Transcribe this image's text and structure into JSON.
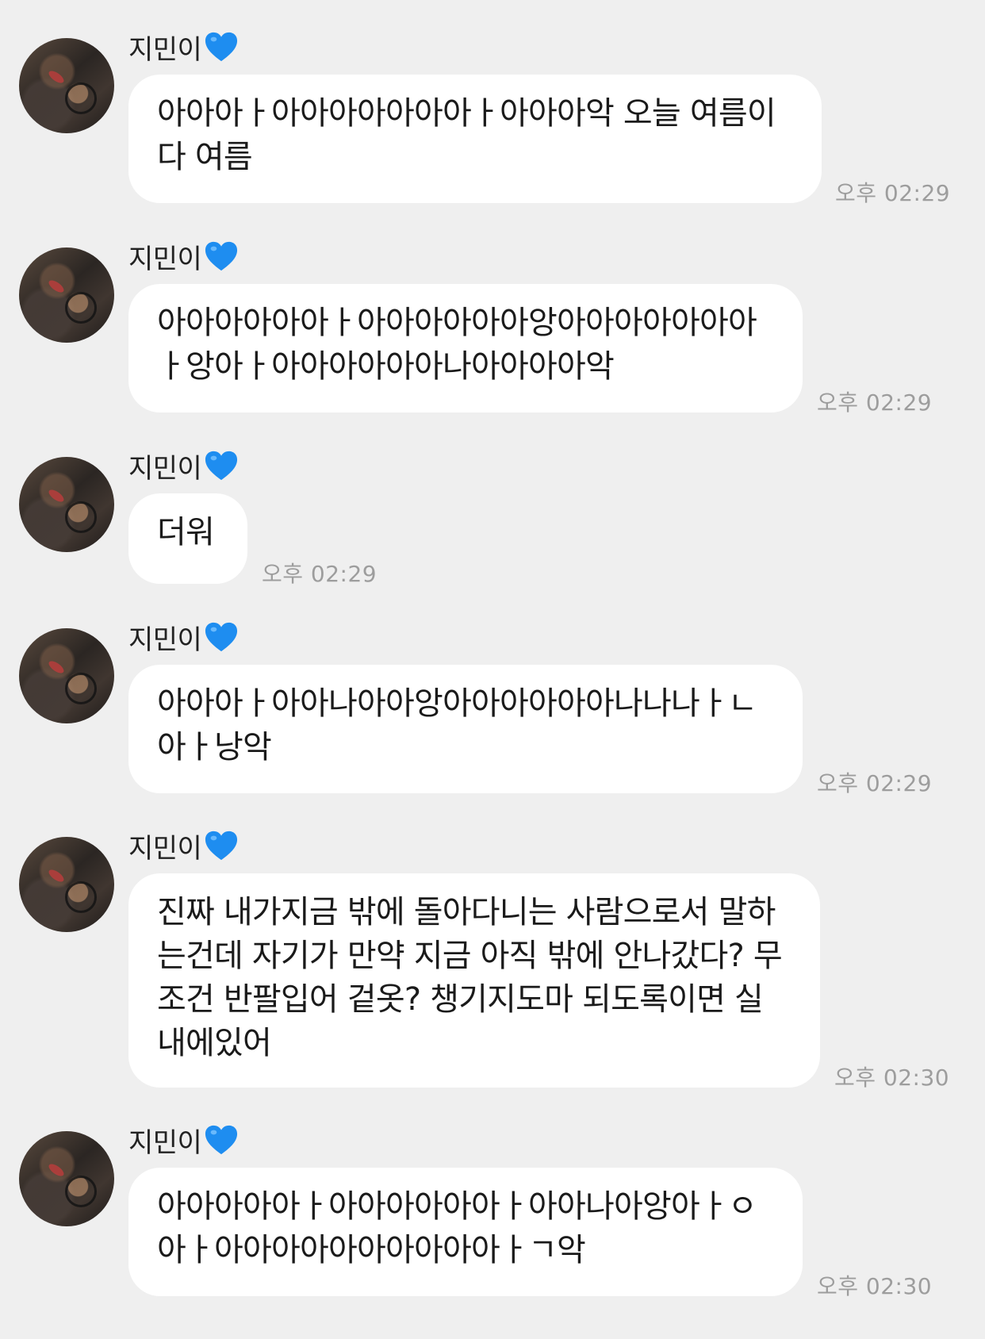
{
  "sender": "지민이",
  "heart_icon": "blue-heart-icon",
  "colors": {
    "background": "#efefef",
    "bubble": "#ffffff",
    "heart": "#1e8df0",
    "timestamp": "#9d9d9d"
  },
  "messages": [
    {
      "text": "아아아ㅏ아아아아아아아ㅏ아아아악 오늘 여름이다 여름",
      "time": "오후 02:29"
    },
    {
      "text": "아아아아아아ㅏ아아아아아아앙아아아아아아아ㅏ앙아ㅏ아아아아아아나아아아아악",
      "time": "오후 02:29"
    },
    {
      "text": "더워",
      "time": "오후 02:29"
    },
    {
      "text": "아아아ㅏ아아나아아앙아아아아아아나나나ㅏㄴ아ㅏ낭악",
      "time": "오후 02:29"
    },
    {
      "text": "진짜 내가지금 밖에 돌아다니는 사람으로서 말하는건데 자기가 만약 지금 아직 밖에 안나갔다? 무조건 반팔입어 겉옷? 챙기지도마 되도록이면 실내에있어",
      "time": "오후 02:30"
    },
    {
      "text": "아아아아아ㅏ아아아아아아ㅏ아아나아앙아ㅏㅇ아ㅏ아아아아아아아아아아ㅏㄱ악",
      "time": "오후 02:30"
    }
  ]
}
